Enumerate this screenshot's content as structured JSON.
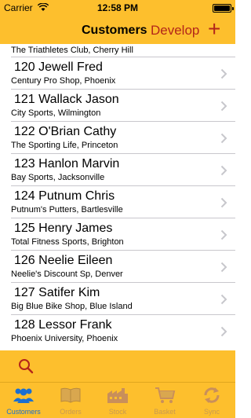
{
  "status_bar": {
    "carrier": "Carrier",
    "time": "12:58 PM"
  },
  "nav": {
    "title": "Customers",
    "develop": "Develop",
    "add_icon": "plus-icon"
  },
  "list": {
    "top_fragment": "The Triathletes Club, Cherry Hill",
    "rows": [
      {
        "name": "120 Jewell Fred",
        "sub": "Century Pro Shop, Phoenix"
      },
      {
        "name": "121 Wallack Jason",
        "sub": "City Sports, Wilmington"
      },
      {
        "name": "122 O'Brian Cathy",
        "sub": "The Sporting Life, Princeton"
      },
      {
        "name": "123 Hanlon Marvin",
        "sub": "Bay Sports, Jacksonville"
      },
      {
        "name": "124 Putnum Chris",
        "sub": "Putnum's Putters, Bartlesville"
      },
      {
        "name": "125 Henry James",
        "sub": "Total Fitness Sports, Brighton"
      },
      {
        "name": "126 Neelie Eileen",
        "sub": "Neelie's Discount Sp, Denver"
      },
      {
        "name": "127 Satifer Kim",
        "sub": "Big Blue Bike Shop, Blue Island"
      },
      {
        "name": "128 Lessor Frank",
        "sub": "Phoenix University, Phoenix"
      }
    ]
  },
  "tabs": [
    {
      "label": "Customers",
      "icon": "customers-icon",
      "active": true
    },
    {
      "label": "Orders",
      "icon": "orders-icon",
      "active": false
    },
    {
      "label": "Stock",
      "icon": "stock-icon",
      "active": false
    },
    {
      "label": "Basket",
      "icon": "basket-icon",
      "active": false
    },
    {
      "label": "Sync",
      "icon": "sync-icon",
      "active": false
    }
  ],
  "colors": {
    "accent": "#fdbf2d",
    "nav_action": "#b3261a",
    "tab_active": "#1a6fd1",
    "tab_inactive": "#c89a52"
  }
}
